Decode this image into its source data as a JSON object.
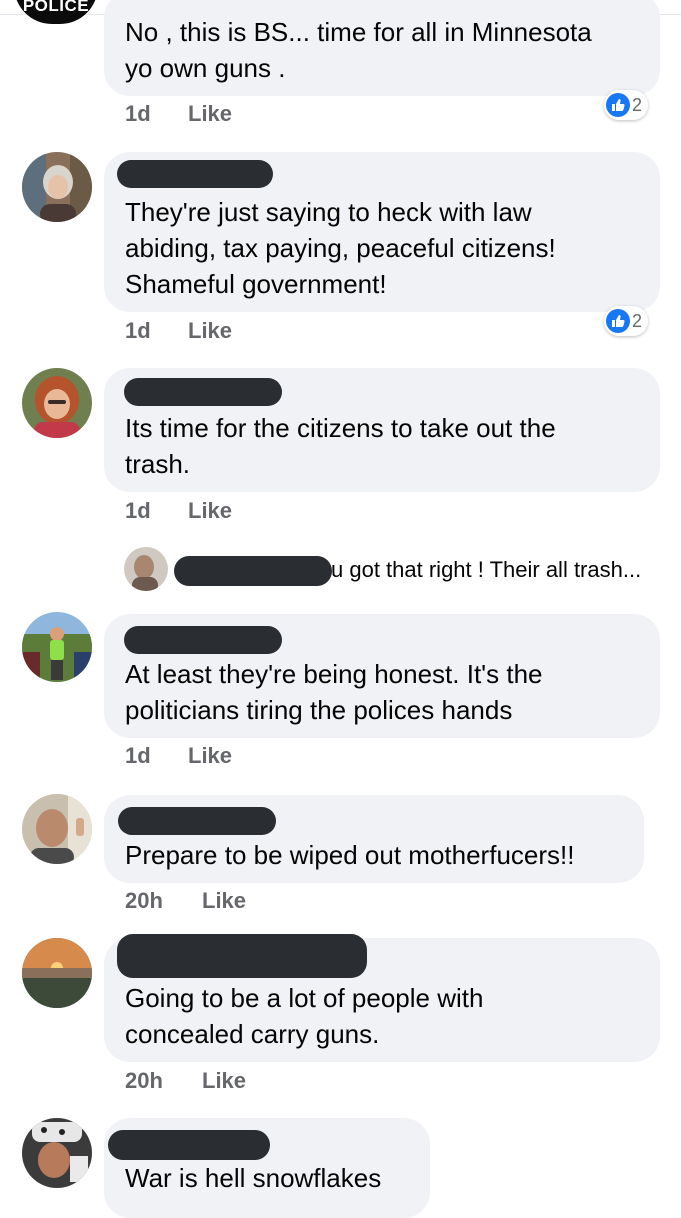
{
  "colors": {
    "bubble": "#f0f2f5",
    "meta_text": "#65676b",
    "like_blue": "#1877f2",
    "redaction": "#2a2d32"
  },
  "comments": [
    {
      "avatar_badge": "POLICE",
      "text": "No , this is BS... time for all in Minnesota\nyo own guns .",
      "time": "1d",
      "like_label": "Like",
      "reaction_icon": "thumbs-up-icon",
      "reaction_count": "2"
    },
    {
      "text": "They're just saying to heck with law\nabiding, tax paying, peaceful citizens!\nShameful government!",
      "time": "1d",
      "like_label": "Like",
      "reaction_icon": "thumbs-up-icon",
      "reaction_count": "2"
    },
    {
      "text": "Its time for the citizens to take out the\ntrash.",
      "time": "1d",
      "like_label": "Like"
    },
    {
      "text": "At least they're being honest.  It's the\npoliticians tiring the polices hands",
      "time": "1d",
      "like_label": "Like"
    },
    {
      "text": "Prepare to be wiped out motherfucers!!",
      "time": "20h",
      "like_label": "Like"
    },
    {
      "text": "Going to be a lot of people with\nconcealed carry guns.",
      "time": "20h",
      "like_label": "Like"
    },
    {
      "text": "War is hell snowflakes"
    }
  ],
  "reply_preview": {
    "text": "u got that right ! Their all trash..."
  }
}
